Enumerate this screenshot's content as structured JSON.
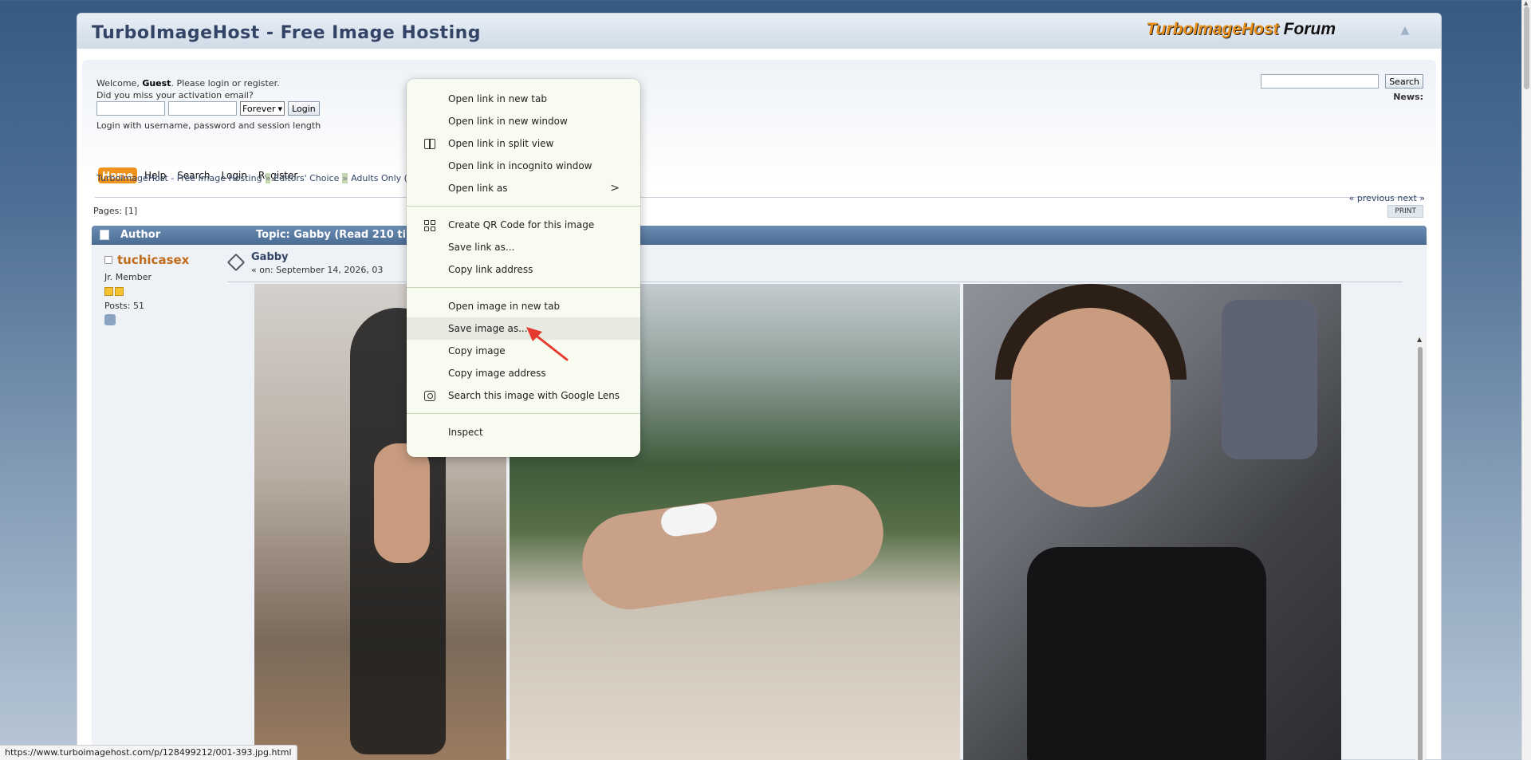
{
  "header": {
    "forum_title": "TurboImageHost - Free Image Hosting",
    "logo_part1": "TurboImageHost",
    "logo_part2": "Forum"
  },
  "user_box": {
    "welcome_prefix": "Welcome, ",
    "guest": "Guest",
    "welcome_suffix": ". Please login or register.",
    "activation": "Did you miss your activation email?",
    "session_option": "Forever",
    "login_button": "Login",
    "login_note": "Login with username, password and session length"
  },
  "search": {
    "button": "Search",
    "news_label": "News:"
  },
  "menu": {
    "items": [
      "Home",
      "Help",
      "Search",
      "Login",
      "Register"
    ]
  },
  "breadcrumb": {
    "items": [
      "TurboImageHost - Free Image Hosting",
      "Editors' Choice",
      "Adults Only ("
    ]
  },
  "nav": {
    "prev_next": "« previous next »",
    "pages": "Pages: [1]",
    "print": "PRINT"
  },
  "topic_bar": {
    "author": "Author",
    "topic": "Topic: Gabby  (Read 210 ti"
  },
  "poster": {
    "name": "tuchicasex",
    "rank": "Jr. Member",
    "posts": "Posts: 51"
  },
  "post": {
    "subject": "Gabby",
    "date": "« on: September 14, 2026, 03"
  },
  "status_bar": {
    "url": "https://www.turboimagehost.com/p/128499212/001-393.jpg.html"
  },
  "context_menu": {
    "group1": [
      {
        "label": "Open link in new tab",
        "icon": ""
      },
      {
        "label": "Open link in new window",
        "icon": ""
      },
      {
        "label": "Open link in split view",
        "icon": "split-view-icon"
      },
      {
        "label": "Open link in incognito window",
        "icon": ""
      },
      {
        "label": "Open link as",
        "icon": "",
        "submenu": ">"
      }
    ],
    "group2": [
      {
        "label": "Create QR Code for this image",
        "icon": "qr-code-icon"
      },
      {
        "label": "Save link as...",
        "icon": ""
      },
      {
        "label": "Copy link address",
        "icon": ""
      }
    ],
    "group3": [
      {
        "label": "Open image in new tab",
        "icon": ""
      },
      {
        "label": "Save image as...",
        "icon": "",
        "highlighted": true
      },
      {
        "label": "Copy image",
        "icon": ""
      },
      {
        "label": "Copy image address",
        "icon": ""
      },
      {
        "label": "Search this image with Google Lens",
        "icon": "google-lens-icon"
      }
    ],
    "group4": [
      {
        "label": "Inspect",
        "icon": ""
      }
    ]
  },
  "colors": {
    "accent_orange": "#f0931c",
    "bar_blue": "#5a7ca3",
    "menu_bg": "#f7fbf0",
    "annotation_red": "#e63a2e"
  }
}
